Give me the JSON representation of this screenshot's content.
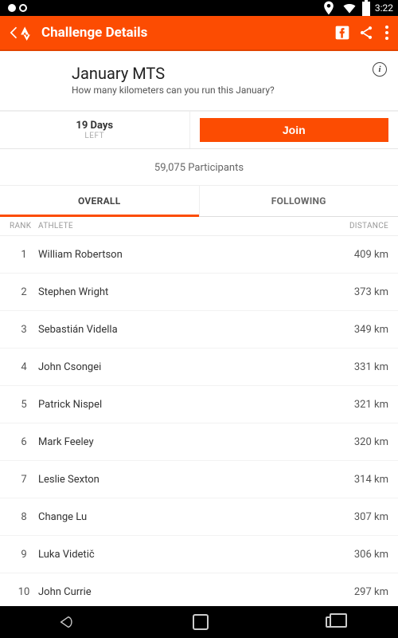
{
  "status": {
    "time": "3:22"
  },
  "appbar": {
    "title": "Challenge Details"
  },
  "hero": {
    "title": "January MTS",
    "subtitle": "How many kilometers can you run this January?"
  },
  "countdown": {
    "days": "19 Days",
    "left": "LEFT"
  },
  "join": {
    "label": "Join"
  },
  "participants": "59,075 Participants",
  "tabs": {
    "overall": "OVERALL",
    "following": "FOLLOWING"
  },
  "headers": {
    "rank": "RANK",
    "athlete": "ATHLETE",
    "distance": "DISTANCE"
  },
  "rows": [
    {
      "rank": "1",
      "athlete": "William Robertson",
      "distance": "409 km"
    },
    {
      "rank": "2",
      "athlete": "Stephen Wright",
      "distance": "373 km"
    },
    {
      "rank": "3",
      "athlete": "Sebastián Vidella",
      "distance": "349 km"
    },
    {
      "rank": "4",
      "athlete": "John Csongei",
      "distance": "331 km"
    },
    {
      "rank": "5",
      "athlete": "Patrick Nispel",
      "distance": "321 km"
    },
    {
      "rank": "6",
      "athlete": "Mark Feeley",
      "distance": "320 km"
    },
    {
      "rank": "7",
      "athlete": "Leslie Sexton",
      "distance": "314 km"
    },
    {
      "rank": "8",
      "athlete": "Change Lu",
      "distance": "307 km"
    },
    {
      "rank": "9",
      "athlete": "Luka Videtič",
      "distance": "306 km"
    },
    {
      "rank": "10",
      "athlete": "John Currie",
      "distance": "297 km"
    }
  ]
}
